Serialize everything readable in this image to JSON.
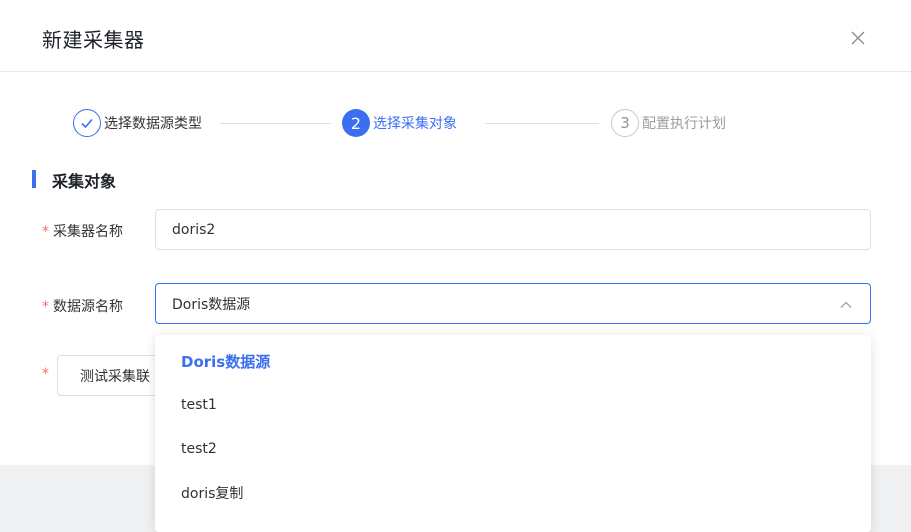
{
  "dialog": {
    "title": "新建采集器"
  },
  "steps": [
    {
      "number": "✓",
      "label": "选择数据源类型",
      "status": "done"
    },
    {
      "number": "2",
      "label": "选择采集对象",
      "status": "active"
    },
    {
      "number": "3",
      "label": "配置执行计划",
      "status": "pending"
    }
  ],
  "section": {
    "title": "采集对象"
  },
  "form": {
    "required_mark": "*",
    "collector_name": {
      "label": "采集器名称",
      "value": "doris2"
    },
    "datasource": {
      "label": "数据源名称",
      "value": "Doris数据源"
    },
    "test_button": {
      "label": "测试采集联"
    }
  },
  "dropdown": {
    "options": [
      "Doris数据源",
      "test1",
      "test2",
      "doris复制"
    ],
    "selected_index": 0
  },
  "colors": {
    "accent": "#3b6ff0",
    "required": "#f56c6c"
  }
}
